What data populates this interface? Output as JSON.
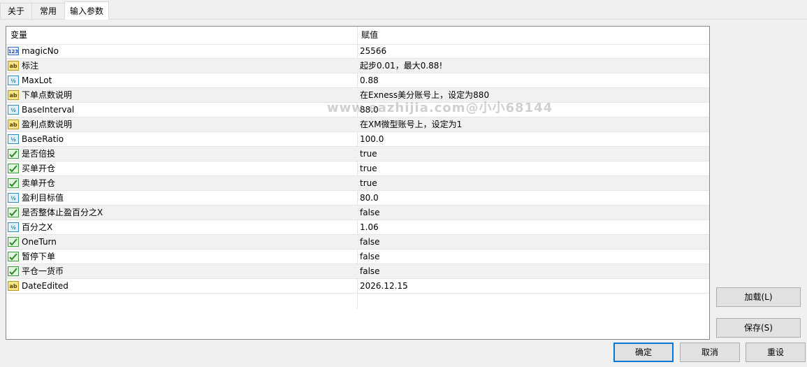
{
  "tabs": [
    {
      "label": "关于"
    },
    {
      "label": "常用"
    },
    {
      "label": "输入参数"
    }
  ],
  "grid": {
    "headers": {
      "variable": "变量",
      "value": "赋值"
    },
    "rows": [
      {
        "type": "int",
        "icon": "integer-type-icon",
        "name": "magicNo",
        "value": "25566"
      },
      {
        "type": "string",
        "icon": "string-type-icon",
        "name": "标注",
        "value": "起步0.01，最大0.88!"
      },
      {
        "type": "double",
        "icon": "double-type-icon",
        "name": "MaxLot",
        "value": "0.88"
      },
      {
        "type": "string",
        "icon": "string-type-icon",
        "name": "下单点数说明",
        "value": "在Exness美分账号上，设定为880"
      },
      {
        "type": "double",
        "icon": "double-type-icon",
        "name": "BaseInterval",
        "value": "88.0"
      },
      {
        "type": "string",
        "icon": "string-type-icon",
        "name": "盈利点数说明",
        "value": "在XM微型账号上，设定为1"
      },
      {
        "type": "double",
        "icon": "double-type-icon",
        "name": "BaseRatio",
        "value": "100.0"
      },
      {
        "type": "bool",
        "icon": "boolean-type-icon",
        "name": "是否倍投",
        "value": "true"
      },
      {
        "type": "bool",
        "icon": "boolean-type-icon",
        "name": "买单开仓",
        "value": "true"
      },
      {
        "type": "bool",
        "icon": "boolean-type-icon",
        "name": "卖单开仓",
        "value": "true"
      },
      {
        "type": "double",
        "icon": "double-type-icon",
        "name": "盈利目标值",
        "value": "80.0"
      },
      {
        "type": "bool",
        "icon": "boolean-type-icon",
        "name": "是否整体止盈百分之X",
        "value": "false"
      },
      {
        "type": "double",
        "icon": "double-type-icon",
        "name": "百分之X",
        "value": "1.06"
      },
      {
        "type": "bool",
        "icon": "boolean-type-icon",
        "name": "OneTurn",
        "value": "false"
      },
      {
        "type": "bool",
        "icon": "boolean-type-icon",
        "name": "暂停下单",
        "value": "false"
      },
      {
        "type": "bool",
        "icon": "boolean-type-icon",
        "name": "平仓一货币",
        "value": "false"
      },
      {
        "type": "string",
        "icon": "string-type-icon",
        "name": "DateEdited",
        "value": "2026.12.15"
      }
    ]
  },
  "watermark": "www.eazhijia.com@小小68144",
  "buttons": {
    "load": "加载(L)",
    "save": "保存(S)",
    "ok": "确定",
    "cancel": "取消",
    "reset": "重设"
  }
}
